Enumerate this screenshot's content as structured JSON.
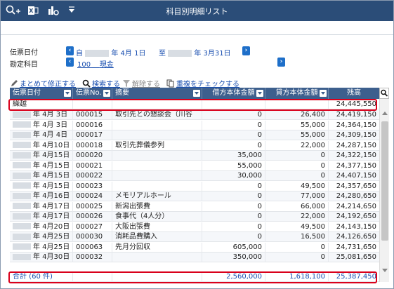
{
  "window": {
    "title": "科目別明細リスト"
  },
  "filters": {
    "date_label": "伝票日付",
    "date_from_prefix": "自",
    "date_from": "年  4月 1日",
    "date_to_prefix": "至",
    "date_to": "年  3月31日",
    "account_label": "勘定科目",
    "account_code": "100",
    "account_name": "現金"
  },
  "toolbar": {
    "bulk_edit": "まとめて修正する",
    "search": "検索する",
    "clear": "解除する",
    "check_dup": "重複をチェックする"
  },
  "grid": {
    "columns": [
      "伝票日付",
      "伝票No.",
      "摘要",
      "借方本体金額",
      "貸方本体金額",
      "残高"
    ],
    "carry": {
      "label": "繰越",
      "balance": "24,445,550"
    },
    "rows": [
      {
        "date": "年  4月  3日",
        "no": "000015",
        "memo": "取引先との懇談会（川谷",
        "debit": "0",
        "credit": "26,400",
        "balance": "24,419,150"
      },
      {
        "date": "年  4月  3日",
        "no": "000016",
        "memo": "",
        "debit": "0",
        "credit": "55,000",
        "balance": "24,364,150"
      },
      {
        "date": "年  4月  4日",
        "no": "000017",
        "memo": "",
        "debit": "0",
        "credit": "55,000",
        "balance": "24,309,150"
      },
      {
        "date": "年  4月10日",
        "no": "000018",
        "memo": "取引先葬儀参列",
        "debit": "0",
        "credit": "22,000",
        "balance": "24,287,150"
      },
      {
        "date": "年  4月15日",
        "no": "000020",
        "memo": "",
        "debit": "35,000",
        "credit": "0",
        "balance": "24,322,150"
      },
      {
        "date": "年  4月15日",
        "no": "000021",
        "memo": "",
        "debit": "55,000",
        "credit": "0",
        "balance": "24,377,150"
      },
      {
        "date": "年  4月15日",
        "no": "000022",
        "memo": "",
        "debit": "30,000",
        "credit": "0",
        "balance": "24,407,150"
      },
      {
        "date": "年  4月15日",
        "no": "000023",
        "memo": "",
        "debit": "0",
        "credit": "49,500",
        "balance": "24,357,650"
      },
      {
        "date": "年  4月16日",
        "no": "000024",
        "memo": "メモリアルホール",
        "debit": "0",
        "credit": "77,000",
        "balance": "24,280,650"
      },
      {
        "date": "年  4月17日",
        "no": "000025",
        "memo": "新潟出張費",
        "debit": "0",
        "credit": "66,000",
        "balance": "24,214,650"
      },
      {
        "date": "年  4月17日",
        "no": "000026",
        "memo": "食事代（4人分）",
        "debit": "0",
        "credit": "22,000",
        "balance": "24,192,650"
      },
      {
        "date": "年  4月20日",
        "no": "000027",
        "memo": "大阪出張費",
        "debit": "0",
        "credit": "49,500",
        "balance": "24,143,150"
      },
      {
        "date": "年  4月25日",
        "no": "000030",
        "memo": "消耗品費購入",
        "debit": "0",
        "credit": "16,500",
        "balance": "24,126,650"
      },
      {
        "date": "年  4月25日",
        "no": "000063",
        "memo": "先月分回収",
        "debit": "605,000",
        "credit": "0",
        "balance": "24,731,650"
      },
      {
        "date": "年  4月30日",
        "no": "000032",
        "memo": "",
        "debit": "350,000",
        "credit": "0",
        "balance": "25,081,650"
      }
    ],
    "total": {
      "label": "合計 (60 件)",
      "debit": "2,560,000",
      "credit": "1,618,100",
      "balance": "25,387,450"
    }
  },
  "colors": {
    "titlebar": "#2b4d78",
    "header": "#3d5f8d",
    "highlight": "#d9001b",
    "link": "#1a4fb0"
  }
}
